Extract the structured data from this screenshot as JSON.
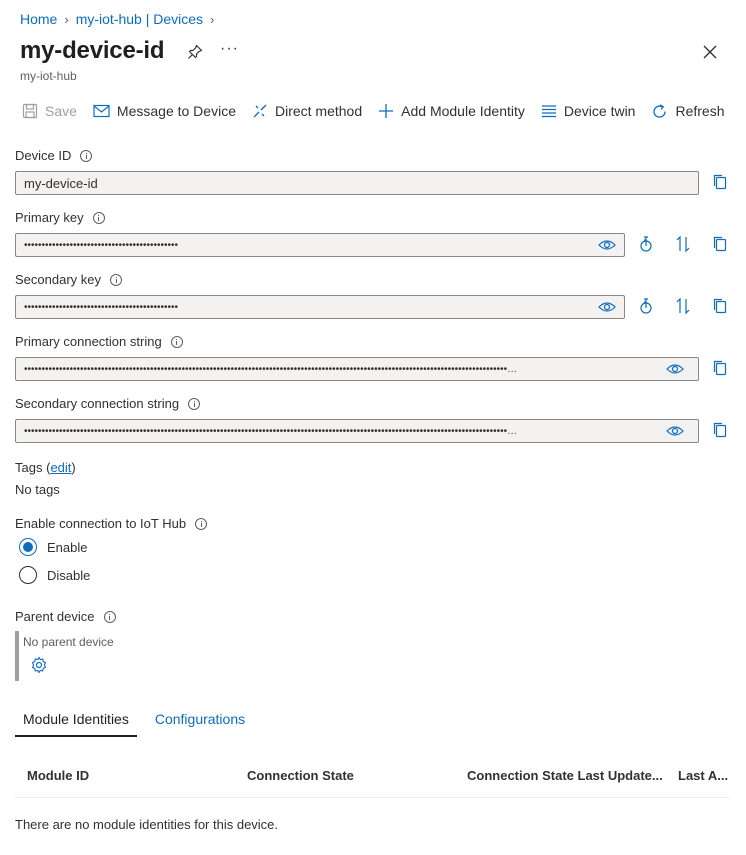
{
  "breadcrumb": {
    "home": "Home",
    "hub": "my-iot-hub | Devices"
  },
  "header": {
    "title": "my-device-id",
    "subtitle": "my-iot-hub",
    "more": "···"
  },
  "toolbar": {
    "save": "Save",
    "message": "Message to Device",
    "direct": "Direct method",
    "add_module": "Add Module Identity",
    "twin": "Device twin",
    "refresh": "Refresh"
  },
  "fields": {
    "device_id": {
      "label": "Device ID",
      "value": "my-device-id"
    },
    "primary_key": {
      "label": "Primary key",
      "value": "••••••••••••••••••••••••••••••••••••••••••••"
    },
    "secondary_key": {
      "label": "Secondary key",
      "value": "••••••••••••••••••••••••••••••••••••••••••••"
    },
    "primary_conn": {
      "label": "Primary connection string",
      "value": "••••••••••••••••••••••••••••••••••••••••••••••••••••••••••••••••••••••••••••••••••••••••••••••••••••••••••••••••••••••••••••••••••••••••••…"
    },
    "secondary_conn": {
      "label": "Secondary connection string",
      "value": "••••••••••••••••••••••••••••••••••••••••••••••••••••••••••••••••••••••••••••••••••••••••••••••••••••••••••••••••••••••••••••••••••••••••••…"
    }
  },
  "tags": {
    "label": "Tags",
    "edit_open": "(",
    "edit": "edit",
    "edit_close": ")",
    "value": "No tags"
  },
  "connection": {
    "label": "Enable connection to IoT Hub",
    "enable": "Enable",
    "disable": "Disable",
    "selected": "Enable"
  },
  "parent": {
    "label": "Parent device",
    "value": "No parent device"
  },
  "tabs": {
    "module_identities": "Module Identities",
    "configurations": "Configurations"
  },
  "table": {
    "columns": [
      "Module ID",
      "Connection State",
      "Connection State Last Update...",
      "Last A..."
    ],
    "empty": "There are no module identities for this device."
  },
  "colors": {
    "accent": "#0f6cbd",
    "field_bg": "#f3f2f1"
  }
}
